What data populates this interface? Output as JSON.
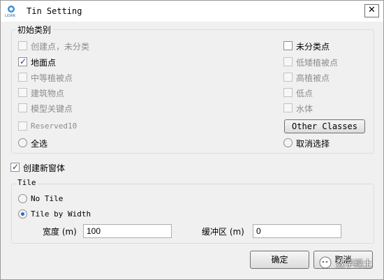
{
  "window": {
    "title": "Tin Setting",
    "close_glyph": "✕"
  },
  "initial_classes": {
    "legend": "初始类别",
    "items": [
      {
        "label": "创建点，未分类",
        "checked": false,
        "enabled": false
      },
      {
        "label": "地面点",
        "checked": true,
        "enabled": true
      },
      {
        "label": "中等植被点",
        "checked": false,
        "enabled": false
      },
      {
        "label": "建筑物点",
        "checked": false,
        "enabled": false
      },
      {
        "label": "模型关键点",
        "checked": false,
        "enabled": false
      },
      {
        "label": "Reserved10",
        "checked": false,
        "enabled": false
      },
      {
        "label": "未分类点",
        "checked": false,
        "enabled": true
      },
      {
        "label": "低矮植被点",
        "checked": false,
        "enabled": false
      },
      {
        "label": "高植被点",
        "checked": false,
        "enabled": false
      },
      {
        "label": "低点",
        "checked": false,
        "enabled": false
      },
      {
        "label": "水体",
        "checked": false,
        "enabled": false
      }
    ],
    "other_classes_button": "Other Classes",
    "select_all": "全选",
    "deselect": "取消选择"
  },
  "create_new_window": {
    "label": "创建新窗体",
    "checked": true
  },
  "tile": {
    "legend": "Tile",
    "options": [
      "No Tile",
      "Tile by Width"
    ],
    "selected": "Tile by Width",
    "width_label": "宽度 (m)",
    "width_value": "100",
    "buffer_label": "缓冲区 (m)",
    "buffer_value": "0"
  },
  "buttons": {
    "ok": "确定",
    "cancel": "取消"
  },
  "watermark": "数字绿土",
  "colors": {
    "accent": "#2a6ad6",
    "disabled_text": "#8d8d8d"
  }
}
